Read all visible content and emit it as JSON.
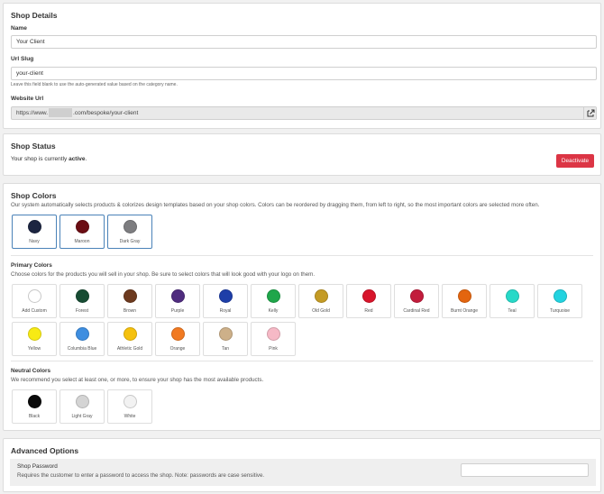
{
  "details": {
    "title": "Shop Details",
    "name_label": "Name",
    "name_value": "Your Client",
    "slug_label": "Url Slug",
    "slug_value": "your-client",
    "slug_help": "Leave this field blank to use the auto-generated value based on the category name.",
    "website_label": "Website Url",
    "website_prefix": "https://www.",
    "website_suffix": ".com/bespoke/your-client"
  },
  "status": {
    "title": "Shop Status",
    "text_prefix": "Your shop is currently ",
    "text_state": "active",
    "text_suffix": ".",
    "deactivate_label": "Deactivate",
    "deactivate_color": "#dc3545"
  },
  "colors": {
    "title": "Shop Colors",
    "description": "Our system automatically selects products & colorizes design templates based on your shop colors. Colors can be reordered by dragging them, from left to right, so the most important colors are selected more often.",
    "selected": [
      {
        "name": "Navy",
        "hex": "#1c2541"
      },
      {
        "name": "Maroon",
        "hex": "#6b0d13"
      },
      {
        "name": "Dark Gray",
        "hex": "#7d7d80"
      }
    ],
    "primary_title": "Primary Colors",
    "primary_description": "Choose colors for the products you will sell in your shop. Be sure to select colors that will look good with your logo on them.",
    "primary": [
      {
        "name": "Add Custom",
        "hex": "#ffffff"
      },
      {
        "name": "Forest",
        "hex": "#174c33"
      },
      {
        "name": "Brown",
        "hex": "#6d3a1f"
      },
      {
        "name": "Purple",
        "hex": "#4f2c7f"
      },
      {
        "name": "Royal",
        "hex": "#1e3ea8"
      },
      {
        "name": "Kelly",
        "hex": "#1fa64a"
      },
      {
        "name": "Old Gold",
        "hex": "#c49b25"
      },
      {
        "name": "Red",
        "hex": "#d8142b"
      },
      {
        "name": "Cardinal Red",
        "hex": "#c21c3c"
      },
      {
        "name": "Burnt Orange",
        "hex": "#e3650f"
      },
      {
        "name": "Teal",
        "hex": "#27d9c8"
      },
      {
        "name": "Turquoise",
        "hex": "#22d3e0"
      },
      {
        "name": "Yellow",
        "hex": "#f7ea14"
      },
      {
        "name": "Columbia Blue",
        "hex": "#3e8ee0"
      },
      {
        "name": "Athletic Gold",
        "hex": "#f5c10e"
      },
      {
        "name": "Orange",
        "hex": "#f17a22"
      },
      {
        "name": "Tan",
        "hex": "#cdb089"
      },
      {
        "name": "Pink",
        "hex": "#f6b9c6"
      }
    ],
    "neutral_title": "Neutral Colors",
    "neutral_description": "We recommend you select at least one, or more, to ensure your shop has the most available products.",
    "neutral": [
      {
        "name": "Black",
        "hex": "#0a0a0a"
      },
      {
        "name": "Light Gray",
        "hex": "#d4d4d4"
      },
      {
        "name": "White",
        "hex": "#f2f2f2"
      }
    ]
  },
  "advanced": {
    "title": "Advanced Options",
    "password_label": "Shop Password",
    "password_help": "Requires the customer to enter a password to access the shop. Note: passwords are case sensitive.",
    "password_value": ""
  }
}
